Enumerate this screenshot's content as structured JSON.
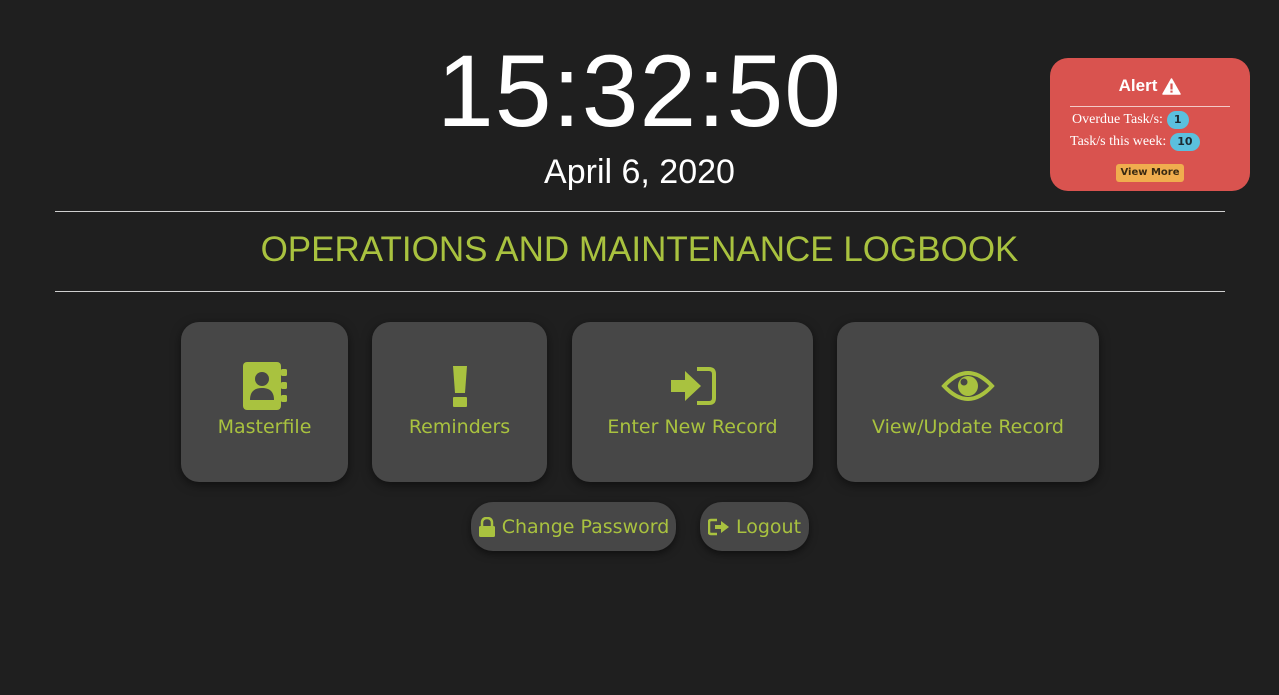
{
  "clock": {
    "time": "15:32:50",
    "date": "April 6, 2020"
  },
  "page": {
    "title": "OPERATIONS AND MAINTENANCE LOGBOOK"
  },
  "tiles": [
    {
      "label": "Masterfile",
      "icon": "address-book-icon"
    },
    {
      "label": "Reminders",
      "icon": "exclamation-icon"
    },
    {
      "label": "Enter New Record",
      "icon": "sign-in-icon"
    },
    {
      "label": "View/Update Record",
      "icon": "eye-icon"
    }
  ],
  "actions": {
    "change_password": "Change Password",
    "logout": "Logout"
  },
  "alert": {
    "title": "Alert",
    "overdue_label": "Overdue Task/s:",
    "overdue_count": "1",
    "week_label": "Task/s this week:",
    "week_count": "10",
    "view_more": "View More"
  },
  "colors": {
    "background": "#1f1f1f",
    "accent": "#a9c23f",
    "tile": "#474747",
    "alert": "#d9534f",
    "badge": "#5bc0de",
    "view_more": "#f0ad4e"
  }
}
